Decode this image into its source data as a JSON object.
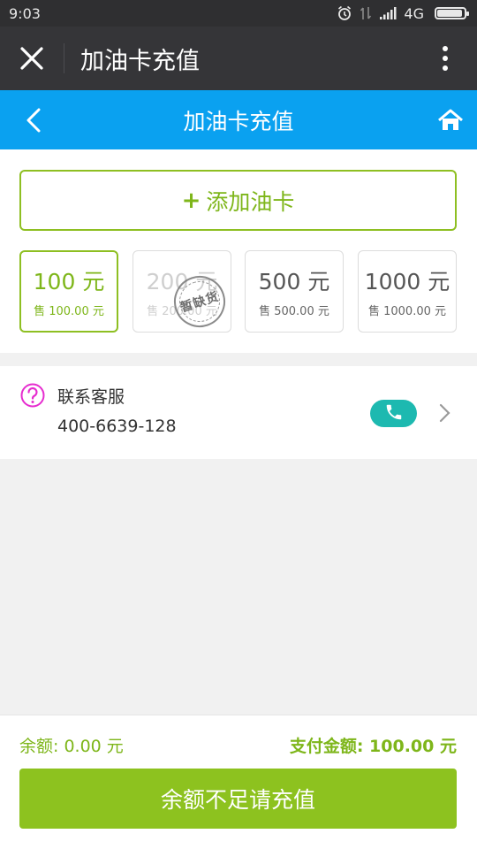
{
  "status_bar": {
    "time": "9:03",
    "network": "4G",
    "icons": [
      "alarm-icon",
      "data-arrows-icon",
      "signal-icon",
      "battery-icon"
    ]
  },
  "title_bar": {
    "title": "加油卡充值",
    "icons": [
      "close-icon",
      "more-vertical-icon"
    ]
  },
  "nav_bar": {
    "title": "加油卡充值",
    "color": "#0aa1f0",
    "icons": [
      "back-icon",
      "home-icon"
    ]
  },
  "add_card": {
    "plus": "+",
    "label": "添加油卡"
  },
  "amounts": [
    {
      "label": "100 元",
      "price": "售 100.00 元",
      "state": "selected"
    },
    {
      "label": "200 元",
      "price": "售 200.00 元",
      "state": "sold-out"
    },
    {
      "label": "500 元",
      "price": "售 500.00 元",
      "state": "normal"
    },
    {
      "label": "1000 元",
      "price": "售 1000.00 元",
      "state": "normal"
    }
  ],
  "sold_out_stamp": "暂缺货",
  "service": {
    "label": "联系客服",
    "phone": "400-6639-128",
    "icons": [
      "question-icon",
      "phone-icon",
      "chevron-right-icon"
    ]
  },
  "footer": {
    "balance": "余额: 0.00 元",
    "pay_amount": "支付金额: 100.00 元",
    "button": "余额不足请充值"
  },
  "colors": {
    "accent_green": "#8dc21f",
    "nav_blue": "#0aa1f0",
    "call_teal": "#1db9b0",
    "question_magenta": "#e62ccf"
  }
}
